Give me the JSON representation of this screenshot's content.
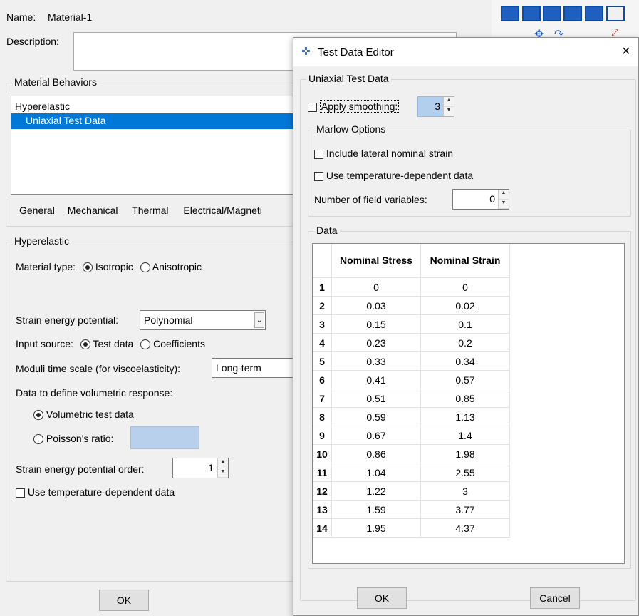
{
  "main": {
    "name_label": "Name:",
    "name_value": "Material-1",
    "description_label": "Description:",
    "behaviors_title": "Material Behaviors",
    "behaviors": [
      "Hyperelastic",
      "Uniaxial Test Data"
    ],
    "menu": [
      "General",
      "Mechanical",
      "Thermal",
      "Electrical/Magneti"
    ],
    "hyper_title": "Hyperelastic",
    "material_type_label": "Material type:",
    "isotropic": "Isotropic",
    "anisotropic": "Anisotropic",
    "sep_label": "Strain energy potential:",
    "sep_value": "Polynomial",
    "input_source_label": "Input source:",
    "test_data": "Test data",
    "coefficients": "Coefficients",
    "moduli_label": "Moduli time scale (for viscoelasticity):",
    "moduli_value": "Long-term",
    "volumetric_label": "Data to define volumetric response:",
    "volumetric_test": "Volumetric test data",
    "poisson": "Poisson's ratio:",
    "order_label": "Strain energy potential order:",
    "order_value": "1",
    "temp_dep": "Use temperature-dependent data",
    "ok": "OK"
  },
  "dialog": {
    "title": "Test Data Editor",
    "close": "×",
    "uniaxial_title": "Uniaxial Test Data",
    "apply_smoothing": "Apply smoothing:",
    "smoothing_value": "3",
    "marlow_title": "Marlow Options",
    "lateral": "Include lateral nominal strain",
    "temp_dep": "Use temperature-dependent data",
    "field_vars_label": "Number of field variables:",
    "field_vars_value": "0",
    "data_title": "Data",
    "headers": [
      "Nominal Stress",
      "Nominal Strain"
    ],
    "rows": [
      [
        "1",
        "0",
        "0"
      ],
      [
        "2",
        "0.03",
        "0.02"
      ],
      [
        "3",
        "0.15",
        "0.1"
      ],
      [
        "4",
        "0.23",
        "0.2"
      ],
      [
        "5",
        "0.33",
        "0.34"
      ],
      [
        "6",
        "0.41",
        "0.57"
      ],
      [
        "7",
        "0.51",
        "0.85"
      ],
      [
        "8",
        "0.59",
        "1.13"
      ],
      [
        "9",
        "0.67",
        "1.4"
      ],
      [
        "10",
        "0.86",
        "1.98"
      ],
      [
        "11",
        "1.04",
        "2.55"
      ],
      [
        "12",
        "1.22",
        "3"
      ],
      [
        "13",
        "1.59",
        "3.77"
      ],
      [
        "14",
        "1.95",
        "4.37"
      ]
    ],
    "ok": "OK",
    "cancel": "Cancel"
  },
  "colors": {
    "selection": "#0078d7",
    "spin_highlight": "#b3cfee",
    "field_highlight": "#b8d0ec"
  }
}
